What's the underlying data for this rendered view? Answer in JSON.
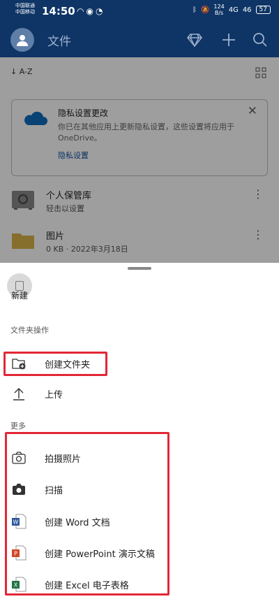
{
  "status_bar": {
    "carrier1": "中国联通",
    "carrier2": "中国移动",
    "time": "14:50",
    "net_speed_value": "124",
    "net_speed_unit": "B/s",
    "signal1": "4G",
    "signal2": "46",
    "battery": "57"
  },
  "app_bar": {
    "title": "文件"
  },
  "toolbar": {
    "sort_label": "A-Z"
  },
  "privacy_card": {
    "title": "隐私设置更改",
    "body": "你已在其他应用上更新隐私设置，这些设置将应用于 OneDrive。",
    "link": "隐私设置"
  },
  "files": [
    {
      "name": "个人保管库",
      "meta": "轻击以设置"
    },
    {
      "name": "图片",
      "meta": "0 KB · 2022年3月18日"
    }
  ],
  "sheet": {
    "new_label": "新建",
    "folder_section": "文件夹操作",
    "more_section": "更多",
    "folder_items": [
      {
        "label": "创建文件夹",
        "icon": "folder-add-icon"
      },
      {
        "label": "上传",
        "icon": "upload-icon"
      }
    ],
    "more_items": [
      {
        "label": "拍摄照片",
        "icon": "camera-outline-icon"
      },
      {
        "label": "扫描",
        "icon": "camera-filled-icon"
      },
      {
        "label": "创建 Word 文档",
        "icon": "word-icon"
      },
      {
        "label": "创建 PowerPoint 演示文稿",
        "icon": "powerpoint-icon"
      },
      {
        "label": "创建 Excel 电子表格",
        "icon": "excel-icon"
      }
    ]
  },
  "colors": {
    "header": "#0f3566",
    "highlight": "#e32736",
    "word": "#2b579a",
    "powerpoint": "#d24726",
    "excel": "#217346"
  }
}
